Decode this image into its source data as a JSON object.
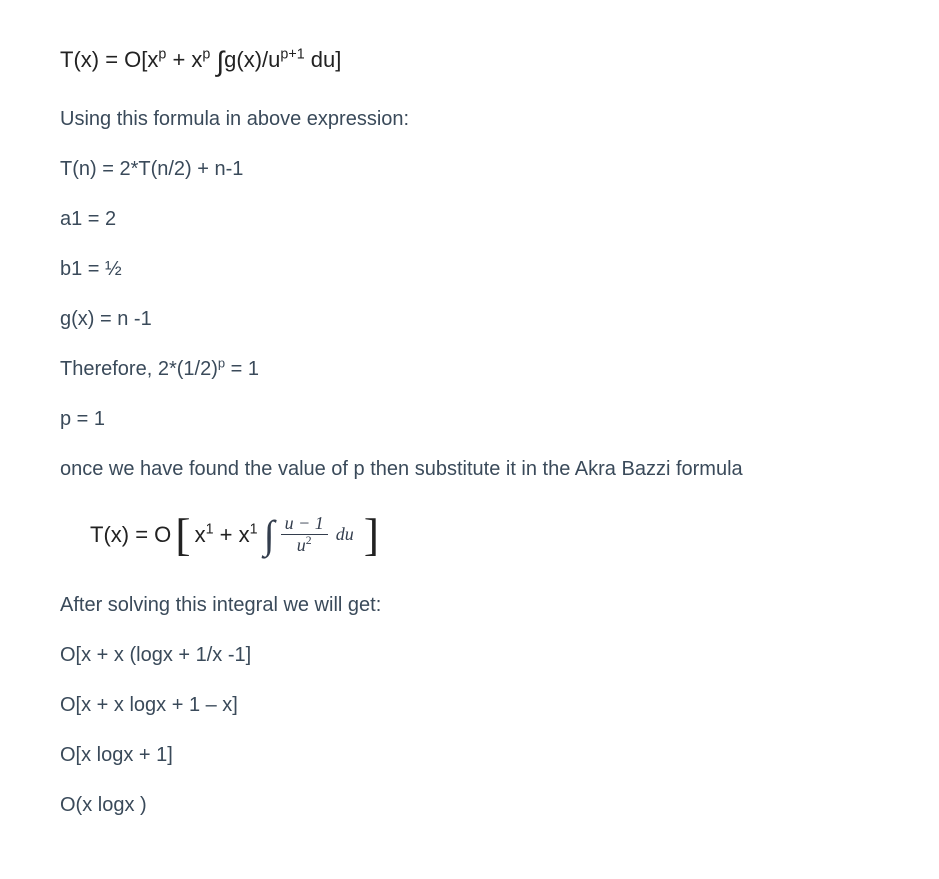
{
  "lines": {
    "formula_top": "T(x) = O[xᵖ + xᵖ ∫g(x)/uᵖ⁺¹ du]",
    "intro": "Using this formula in above expression:",
    "recurrence": "T(n) = 2*T(n/2) + n-1",
    "a1": "a1 = 2",
    "b1": "b1 = ½",
    "gx": "g(x) = n -1",
    "therefore": "Therefore, 2*(1/2)ᵖ = 1",
    "p1": "p = 1",
    "substitute": "once we have found the value of p then substitute it in the Akra Bazzi formula",
    "eq_left": "T(x) = O",
    "eq_inside_left": "x¹ + x¹",
    "frac_num": "u − 1",
    "frac_den": "u²",
    "du": "du",
    "after": "After solving this integral we will get:",
    "r1": "O[x + x (logx + 1/x -1]",
    "r2": "O[x + x logx + 1 – x]",
    "r3": "O[x logx + 1]",
    "r4": "O(x logx )"
  }
}
